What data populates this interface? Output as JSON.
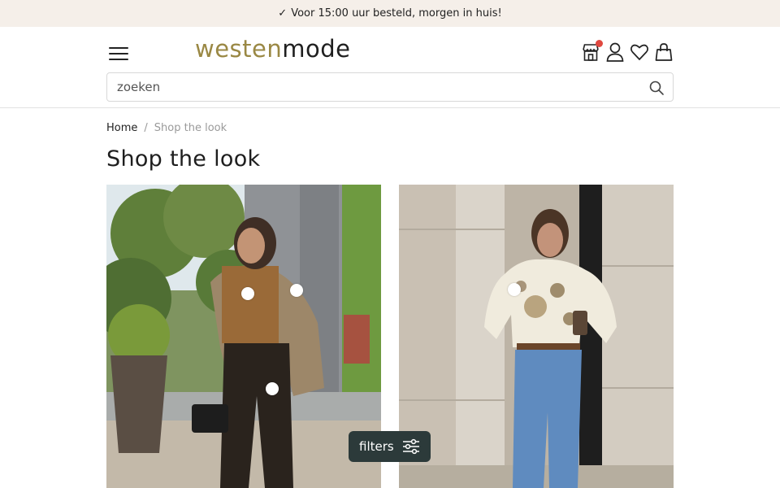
{
  "topbar": {
    "check": "✓",
    "message": "Voor 15:00 uur besteld, morgen in huis!"
  },
  "header": {
    "logo_part1": "westen",
    "logo_part2": "mode",
    "icons": [
      "store-icon",
      "user-icon",
      "heart-icon",
      "bag-icon"
    ],
    "store_badge_color": "#e0483f"
  },
  "search": {
    "placeholder": "zoeken",
    "value": ""
  },
  "breadcrumb": {
    "home": "Home",
    "separator": "/",
    "current": "Shop the look"
  },
  "page": {
    "title": "Shop the look"
  },
  "looks": [
    {
      "hotspot_count": 3
    },
    {
      "hotspot_count": 1
    }
  ],
  "filters": {
    "label": "filters"
  },
  "colors": {
    "brand_gold": "#9a8844",
    "topbar_bg": "#f5efe9",
    "filters_bg": "#2c3a3a"
  }
}
